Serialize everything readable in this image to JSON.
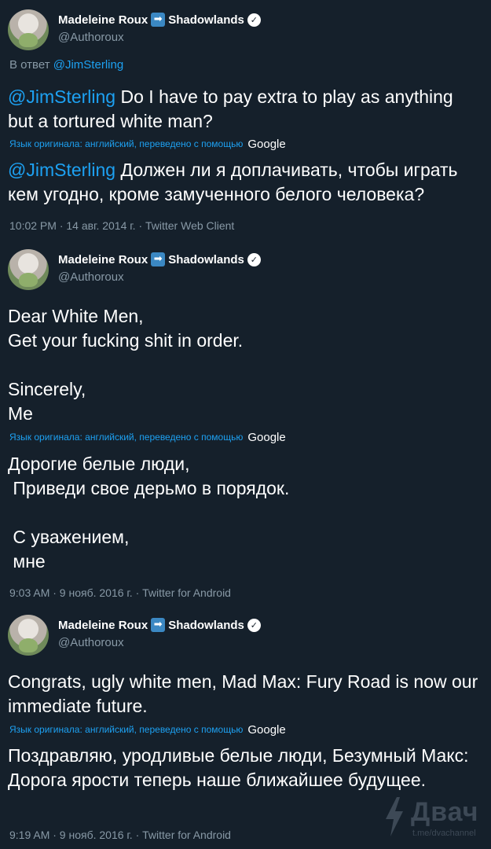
{
  "colors": {
    "background": "#15202b",
    "text": "#ffffff",
    "muted": "#8899a6",
    "link": "#1da1f2"
  },
  "author": {
    "name": "Madeleine Roux",
    "arrow_emoji": "➡",
    "name_suffix": "Shadowlands",
    "verified_icon": "verified-badge-icon",
    "handle": "@Authoroux"
  },
  "translation_note": "Язык оригинала: английский, переведено с помощью",
  "translation_provider": "Google",
  "tweets": [
    {
      "reply_prefix": "В ответ",
      "reply_mention": "@JimSterling",
      "text_mention": "@JimSterling",
      "text": " Do I have to pay extra to play as anything but a tortured white man?",
      "translated_mention": "@JimSterling",
      "translated": " Должен ли я доплачивать, чтобы играть кем угодно, кроме замученного белого человека?",
      "meta": "10:02 PM · 14 авг. 2014 г. · Twitter Web Client"
    },
    {
      "text": "Dear White Men,\nGet your fucking shit in order.\n\nSincerely,\nMe",
      "translated": "Дорогие белые люди,\n Приведи свое дерьмо в порядок.\n\n С уважением,\n мне",
      "meta": "9:03 AM · 9 нояб. 2016 г. · Twitter for Android"
    },
    {
      "text": "Congrats, ugly white men, Mad Max: Fury Road is now our immediate future.",
      "translated": "Поздравляю, уродливые белые люди, Безумный Макс: Дорога ярости теперь наше ближайшее будущее.",
      "meta": "9:19 AM · 9 нояб. 2016 г. · Twitter for Android"
    }
  ],
  "watermark": {
    "title": "Двач",
    "subtitle": "t.me/dvachannel"
  }
}
